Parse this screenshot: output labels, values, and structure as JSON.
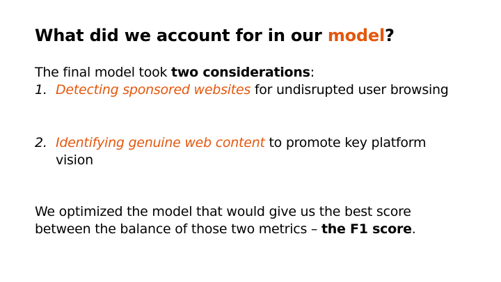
{
  "title": {
    "part1": "What did we account for in our ",
    "accent": "model",
    "part2": "?"
  },
  "intro": {
    "text": "The final model took ",
    "bold": "two considerations",
    "end": ":"
  },
  "items": [
    {
      "number": "1.",
      "highlight": "Detecting sponsored websites",
      "rest": " for undisrupted user browsing"
    },
    {
      "number": "2.",
      "highlight": "Identifying genuine web content",
      "rest": " to promote key platform vision"
    }
  ],
  "closing": {
    "text": "We optimized the model that would give us the best score between the balance of those two metrics – ",
    "bold": "the F1 score",
    "end": "."
  },
  "colors": {
    "accent": "#e4570d",
    "text": "#000000",
    "background": "#ffffff"
  }
}
